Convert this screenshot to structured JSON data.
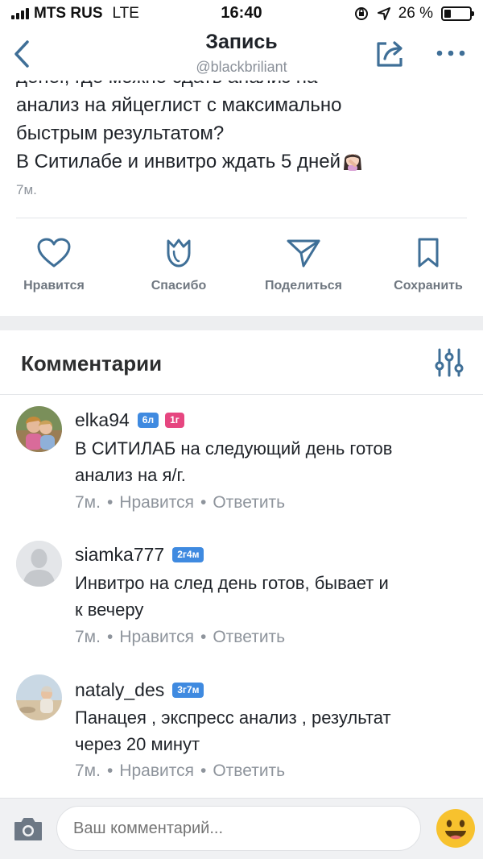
{
  "status_bar": {
    "carrier": "MTS RUS",
    "network": "LTE",
    "time": "16:40",
    "battery_text": "26 %",
    "battery_level": 0.26
  },
  "header": {
    "title": "Запись",
    "subtitle": "@blackbriliant"
  },
  "post": {
    "text": "денег, где можно сдать анализ на\nанализ на яйцеглист с максимально\nбыстрым результатом?\nВ Ситилабе и инвитро ждать 5 дней",
    "time": "7м."
  },
  "actions": [
    {
      "label": "Нравится",
      "icon": "heart-icon"
    },
    {
      "label": "Спасибо",
      "icon": "tulip-icon"
    },
    {
      "label": "Поделиться",
      "icon": "paper-plane-icon"
    },
    {
      "label": "Сохранить",
      "icon": "bookmark-icon"
    }
  ],
  "comments_section": {
    "title": "Комментарии"
  },
  "comments": [
    {
      "username": "elka94",
      "badges": [
        "6л",
        "1г"
      ],
      "text": "В СИТИЛАБ на следующий день готов\nанализ на я/г.",
      "time": "7м.",
      "like_label": "Нравится",
      "reply_label": "Ответить"
    },
    {
      "username": "siamka777",
      "badges": [
        "2г4м"
      ],
      "text": "Инвитро на след день готов, бывает и\nк вечеру",
      "time": "7м.",
      "like_label": "Нравится",
      "reply_label": "Ответить"
    },
    {
      "username": "nataly_des",
      "badges": [
        "3г7м"
      ],
      "text": "Панацея , экспресс анализ , результат\nчерез 20 минут",
      "time": "7м.",
      "like_label": "Нравится",
      "reply_label": "Ответить"
    }
  ],
  "bottom_bar": {
    "input_placeholder": "Ваш комментарий..."
  },
  "colors": {
    "accent": "#3f8ae0",
    "badge_pink": "#e64680",
    "icon": "#3f6f97",
    "secondary_text": "#8e949c"
  }
}
